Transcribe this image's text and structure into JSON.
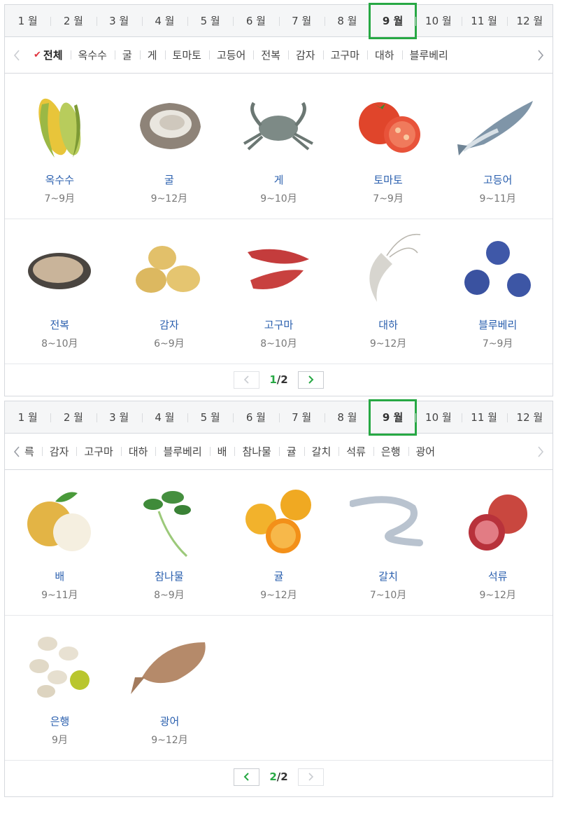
{
  "months": [
    "1 월",
    "2 월",
    "3 월",
    "4 월",
    "5 월",
    "6 월",
    "7 월",
    "8 월",
    "9 월",
    "10 월",
    "11 월",
    "12 월"
  ],
  "selected_month": "9 월",
  "colors": {
    "accent": "#27a844",
    "link": "#2a5fae",
    "check": "#e0323c"
  },
  "panel1": {
    "food_tabs": [
      "옥수수",
      "굴",
      "게",
      "토마토",
      "고등어",
      "전복",
      "감자",
      "고구마",
      "대하",
      "블루베리"
    ],
    "all_label": "전체",
    "rows": [
      [
        {
          "name": "옥수수",
          "period": "7~9月",
          "icon": "corn-icon"
        },
        {
          "name": "굴",
          "period": "9~12月",
          "icon": "oyster-icon"
        },
        {
          "name": "게",
          "period": "9~10月",
          "icon": "crab-icon"
        },
        {
          "name": "토마토",
          "period": "7~9月",
          "icon": "tomato-icon"
        },
        {
          "name": "고등어",
          "period": "9~11月",
          "icon": "mackerel-icon"
        }
      ],
      [
        {
          "name": "전복",
          "period": "8~10月",
          "icon": "abalone-icon"
        },
        {
          "name": "감자",
          "period": "6~9月",
          "icon": "potato-icon"
        },
        {
          "name": "고구마",
          "period": "8~10月",
          "icon": "sweet-potato-icon"
        },
        {
          "name": "대하",
          "period": "9~12月",
          "icon": "shrimp-icon"
        },
        {
          "name": "블루베리",
          "period": "7~9月",
          "icon": "blueberry-icon"
        }
      ]
    ],
    "page_current": "1",
    "page_total": "/2"
  },
  "panel2": {
    "food_tabs": [
      "륵",
      "감자",
      "고구마",
      "대하",
      "블루베리",
      "배",
      "참나물",
      "귤",
      "갈치",
      "석류",
      "은행",
      "광어"
    ],
    "rows": [
      [
        {
          "name": "배",
          "period": "9~11月",
          "icon": "pear-icon"
        },
        {
          "name": "참나물",
          "period": "8~9月",
          "icon": "chamnamul-icon"
        },
        {
          "name": "귤",
          "period": "9~12月",
          "icon": "tangerine-icon"
        },
        {
          "name": "갈치",
          "period": "7~10月",
          "icon": "hairtail-icon"
        },
        {
          "name": "석류",
          "period": "9~12月",
          "icon": "pomegranate-icon"
        }
      ],
      [
        {
          "name": "은행",
          "period": "9月",
          "icon": "ginkgo-icon"
        },
        {
          "name": "광어",
          "period": "9~12月",
          "icon": "flatfish-icon"
        }
      ]
    ],
    "page_current": "2",
    "page_total": "/2"
  }
}
